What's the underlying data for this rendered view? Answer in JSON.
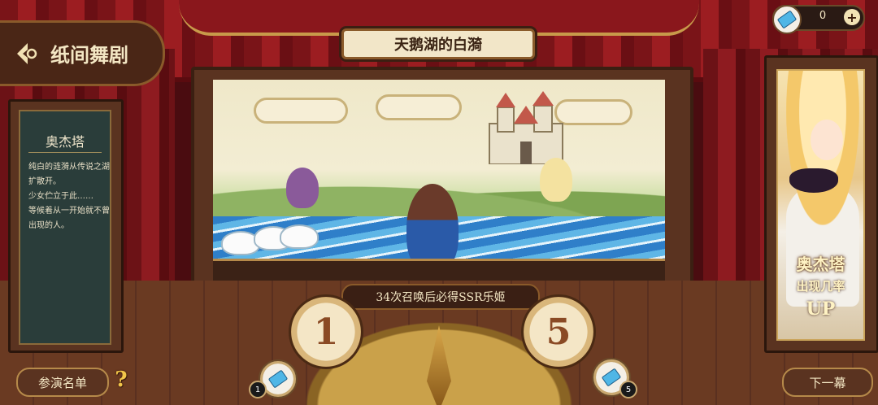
{
  "header": {
    "menu_title": "纸间舞剧",
    "stage_title": "天鹅湖的白漪"
  },
  "currency": {
    "amount": "0"
  },
  "character_info": {
    "name": "奥杰塔",
    "description": "纯白的涟漪从传说之湖\n扩散开。\n少女伫立于此……\n等候着从一开始就不曾\n出现的人。"
  },
  "banner": {
    "name": "奥杰塔",
    "rate_text": "出现几率",
    "up_text": "UP"
  },
  "summon": {
    "pity_text": "34次召唤后必得SSR乐姬",
    "single_label": "1",
    "multi_label": "5",
    "single_cost": "1",
    "multi_cost": "5"
  },
  "footer": {
    "cast_list_label": "参演名单",
    "help_label": "?",
    "next_act_label": "下一幕"
  },
  "colors": {
    "curtain": "#8e1b20",
    "wood": "#5a3320",
    "gold": "#c89a4a",
    "text_light": "#f4e7c4"
  }
}
